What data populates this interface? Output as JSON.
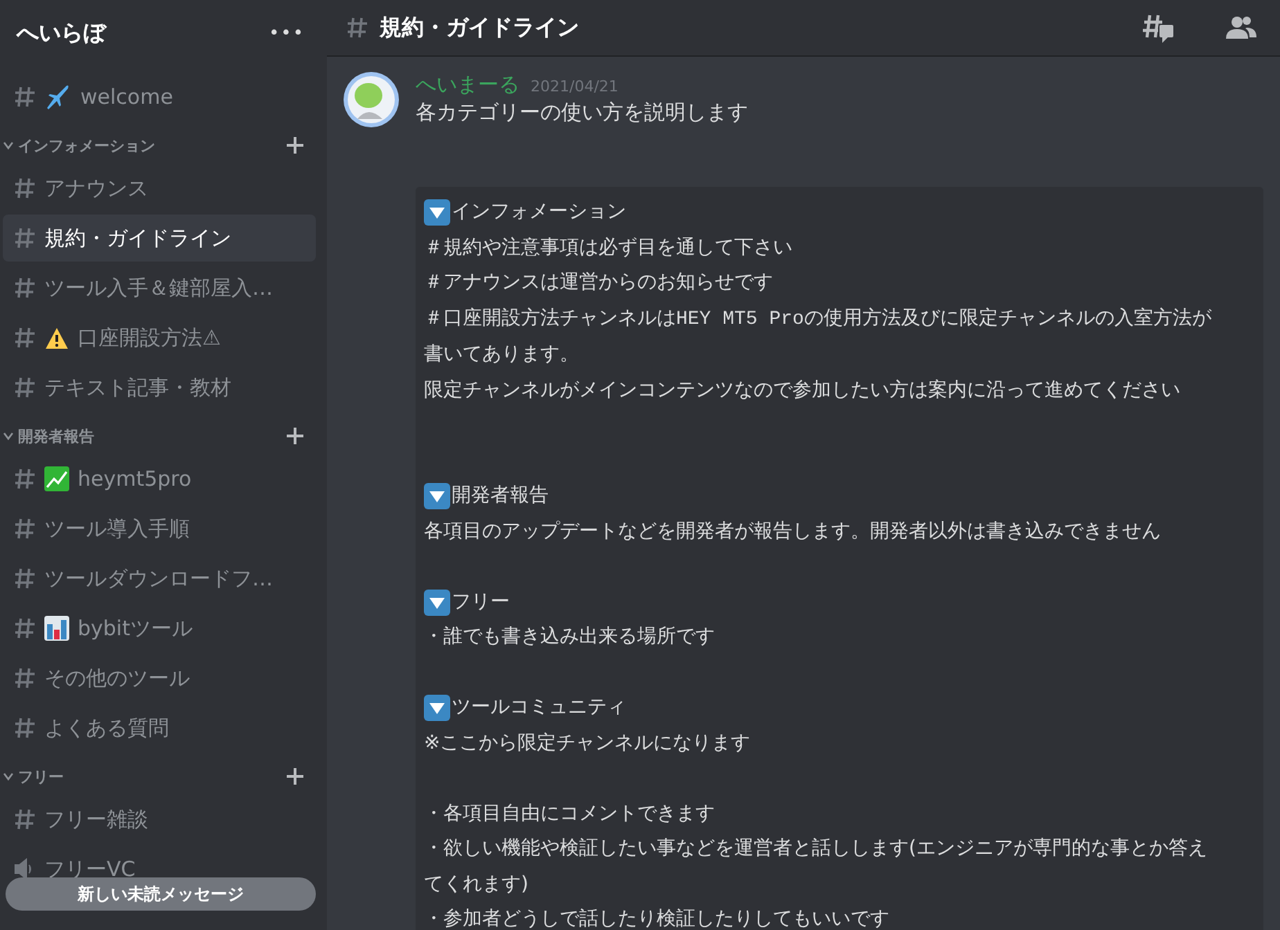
{
  "server": {
    "name": "へいらぼ",
    "menu": "•••"
  },
  "sidebar": {
    "sections": [
      {
        "channels": [
          {
            "name": "welcome",
            "kind": "plane",
            "selected": false
          }
        ]
      },
      {
        "category": "インフォメーション",
        "expanded": true,
        "channels": [
          {
            "name": "アナウンス",
            "kind": "plain",
            "selected": false
          },
          {
            "name": "規約・ガイドライン",
            "kind": "plain",
            "selected": true
          },
          {
            "name": "ツール入手＆鍵部屋入…",
            "kind": "plain",
            "selected": false
          },
          {
            "name": "口座開設方法⚠",
            "kind": "warning",
            "selected": false
          },
          {
            "name": "テキスト記事・教材",
            "kind": "plain",
            "selected": false
          }
        ]
      },
      {
        "category": "開発者報告",
        "expanded": true,
        "channels": [
          {
            "name": "heymt5pro",
            "kind": "yen-chart",
            "selected": false
          },
          {
            "name": "ツール導入手順",
            "kind": "plain",
            "selected": false
          },
          {
            "name": "ツールダウンロードフ…",
            "kind": "plain",
            "selected": false
          },
          {
            "name": "bybitツール",
            "kind": "bar-chart",
            "selected": false
          },
          {
            "name": "その他のツール",
            "kind": "plain",
            "selected": false
          },
          {
            "name": "よくある質問",
            "kind": "plain",
            "selected": false
          }
        ]
      },
      {
        "category": "フリー",
        "expanded": true,
        "channels": [
          {
            "name": "フリー雑談",
            "kind": "plain",
            "selected": false
          },
          {
            "name": "フリーVC",
            "kind": "voice",
            "selected": false
          }
        ]
      }
    ],
    "unread_pill": "新しい未読メッセージ"
  },
  "header": {
    "channel": "規約・ガイドライン"
  },
  "message": {
    "author": "へいまーる",
    "date": "2021/04/21",
    "text": "各カテゴリーの使い方を説明します",
    "block": [
      {
        "kind": "heading",
        "text": "インフォメーション"
      },
      {
        "kind": "text",
        "text": "＃規約や注意事項は必ず目を通して下さい"
      },
      {
        "kind": "text",
        "text": "＃アナウンスは運営からのお知らせです"
      },
      {
        "kind": "text",
        "parts": [
          {
            "text": "＃口座開設方法チャンネルは"
          },
          {
            "text": "HEY MT5 Pro",
            "code": true
          },
          {
            "text": "の使用方法及びに限定チャンネルの入室方法が書いてあります。"
          }
        ]
      },
      {
        "kind": "text",
        "text": "限定チャンネルがメインコンテンツなので参加したい方は案内に沿って進めてください"
      },
      {
        "kind": "blank"
      },
      {
        "kind": "blank"
      },
      {
        "kind": "heading",
        "text": "開発者報告"
      },
      {
        "kind": "text",
        "text": "各項目のアップデートなどを開発者が報告します。開発者以外は書き込みできません"
      },
      {
        "kind": "blank"
      },
      {
        "kind": "heading",
        "text": "フリー"
      },
      {
        "kind": "text",
        "text": "・誰でも書き込み出来る場所です"
      },
      {
        "kind": "blank"
      },
      {
        "kind": "heading",
        "text": "ツールコミュニティ"
      },
      {
        "kind": "text",
        "text": "※ここから限定チャンネルになります"
      },
      {
        "kind": "blank"
      },
      {
        "kind": "text",
        "text": "・各項目自由にコメントできます"
      },
      {
        "kind": "text",
        "text": "・欲しい機能や検証したい事などを運営者と話しします(エンジニアが専門的な事とか答えてくれます)"
      },
      {
        "kind": "text",
        "text": "・参加者どうしで話したり検証したりしてもいいです"
      }
    ]
  }
}
